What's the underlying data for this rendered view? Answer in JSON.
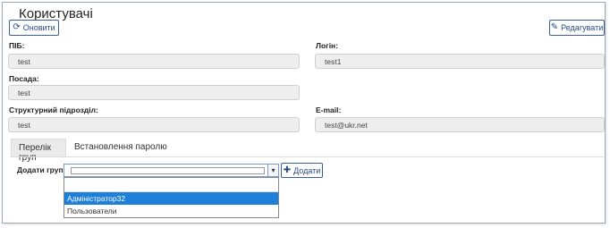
{
  "header": {
    "title": "Користувачі",
    "refresh_label": "Оновити",
    "edit_label": "Редагувати"
  },
  "fields": {
    "pib": {
      "label": "ПІБ:",
      "value": "test"
    },
    "login": {
      "label": "Логін:",
      "value": "test1"
    },
    "position": {
      "label": "Посада:",
      "value": "test"
    },
    "department": {
      "label": "Структурний підрозділ:",
      "value": "test"
    },
    "email": {
      "label": "E-mail:",
      "value": "test@ukr.net"
    }
  },
  "tabs": [
    {
      "label": "Перелік груп",
      "active": true
    },
    {
      "label": "Встановлення паролю",
      "active": false
    }
  ],
  "groups": {
    "add_label": "Додати групу:",
    "add_button": "Додати",
    "options": [
      "Адміністратор32",
      "Пользователи"
    ],
    "highlighted_option": "Адміністратор32"
  },
  "icons": {
    "refresh": "refresh-icon",
    "edit": "edit-icon",
    "add": "plus-icon",
    "dropdown": "chevron-down-icon"
  },
  "colors": {
    "accent": "#2a4a80",
    "highlight": "#1e7fd8",
    "field_bg": "#eeeeee"
  }
}
